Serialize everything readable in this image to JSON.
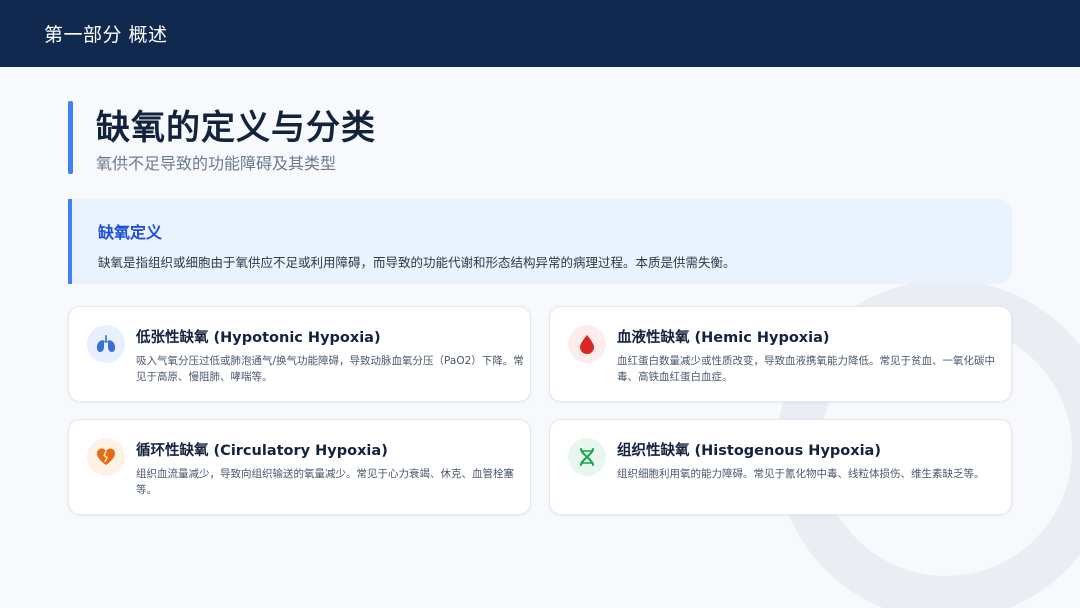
{
  "header": {
    "section_title": "第一部分 概述"
  },
  "page": {
    "title": "缺氧的定义与分类",
    "subtitle": "氧供不足导致的功能障碍及其类型"
  },
  "definition": {
    "title": "缺氧定义",
    "text": "缺氧是指组织或细胞由于氧供应不足或利用障碍，而导致的功能代谢和形态结构异常的病理过程。本质是供需失衡。"
  },
  "cards": [
    {
      "icon": "lungs-icon",
      "icon_color": "#3b6fd6",
      "icon_bg": "#e8f0fe",
      "title": "低张性缺氧 (Hypotonic Hypoxia)",
      "desc": "吸入气氧分压过低或肺泡通气/换气功能障碍，导致动脉血氧分压（PaO2）下降。常见于高原、慢阻肺、哮喘等。"
    },
    {
      "icon": "blood-drop-icon",
      "icon_color": "#dc2626",
      "icon_bg": "#fdecec",
      "title": "血液性缺氧 (Hemic Hypoxia)",
      "desc": "血红蛋白数量减少或性质改变，导致血液携氧能力降低。常见于贫血、一氧化碳中毒、高铁血红蛋白血症。"
    },
    {
      "icon": "heart-broken-icon",
      "icon_color": "#ea6a12",
      "icon_bg": "#fef1e6",
      "title": "循环性缺氧 (Circulatory Hypoxia)",
      "desc": "组织血流量减少，导致向组织输送的氧量减少。常见于心力衰竭、休克、血管栓塞等。"
    },
    {
      "icon": "dna-icon",
      "icon_color": "#16a34a",
      "icon_bg": "#e8f7ee",
      "title": "组织性缺氧 (Histogenous Hypoxia)",
      "desc": "组织细胞利用氧的能力障碍。常见于氰化物中毒、线粒体损伤、维生素缺乏等。"
    }
  ]
}
